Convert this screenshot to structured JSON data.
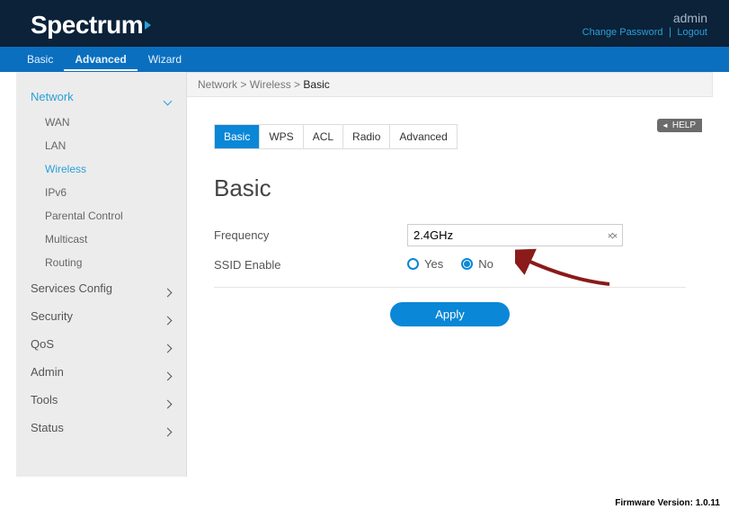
{
  "brand": "Spectrum",
  "user": "admin",
  "links": {
    "change_pw": "Change Password",
    "logout": "Logout"
  },
  "nav": {
    "items": [
      "Basic",
      "Advanced",
      "Wizard"
    ],
    "active": "Advanced"
  },
  "sidebar": {
    "groups": [
      {
        "label": "Network",
        "expanded": true,
        "active": true,
        "items": [
          "WAN",
          "LAN",
          "Wireless",
          "IPv6",
          "Parental Control",
          "Multicast",
          "Routing"
        ],
        "active_item": "Wireless"
      },
      {
        "label": "Services Config"
      },
      {
        "label": "Security"
      },
      {
        "label": "QoS"
      },
      {
        "label": "Admin"
      },
      {
        "label": "Tools"
      },
      {
        "label": "Status"
      }
    ]
  },
  "breadcrumb": {
    "a": "Network",
    "b": "Wireless",
    "c": "Basic"
  },
  "tabs": {
    "items": [
      "Basic",
      "WPS",
      "ACL",
      "Radio",
      "Advanced"
    ],
    "active": "Basic"
  },
  "help_label": "HELP",
  "section_title": "Basic",
  "form": {
    "frequency_label": "Frequency",
    "frequency_value": "2.4GHz",
    "ssid_enable_label": "SSID Enable",
    "ssid_yes": "Yes",
    "ssid_no": "No",
    "ssid_selected": "No"
  },
  "apply_label": "Apply",
  "footer": {
    "label": "Firmware Version:",
    "value": "1.0.11"
  }
}
